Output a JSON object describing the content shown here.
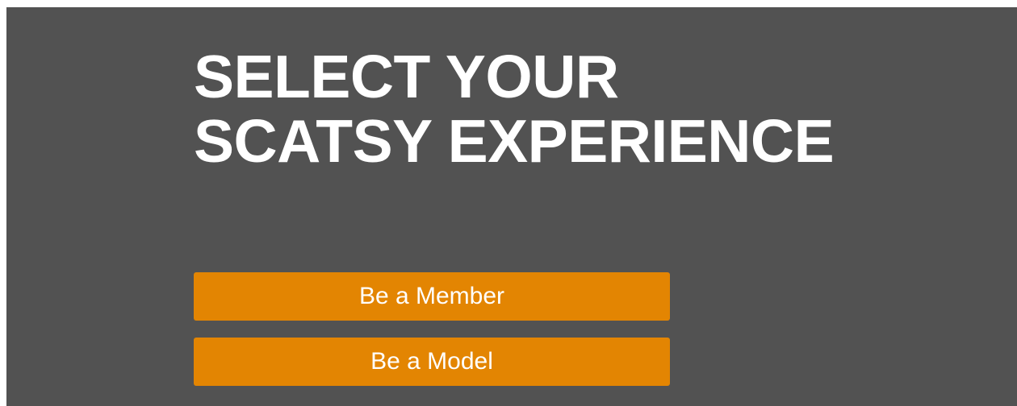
{
  "heading": {
    "line1": "SELECT YOUR",
    "line2": "SCATSY EXPERIENCE"
  },
  "buttons": {
    "member_label": "Be a Member",
    "model_label": "Be a Model"
  },
  "colors": {
    "background": "#525252",
    "button": "#e38502",
    "text": "#ffffff"
  }
}
